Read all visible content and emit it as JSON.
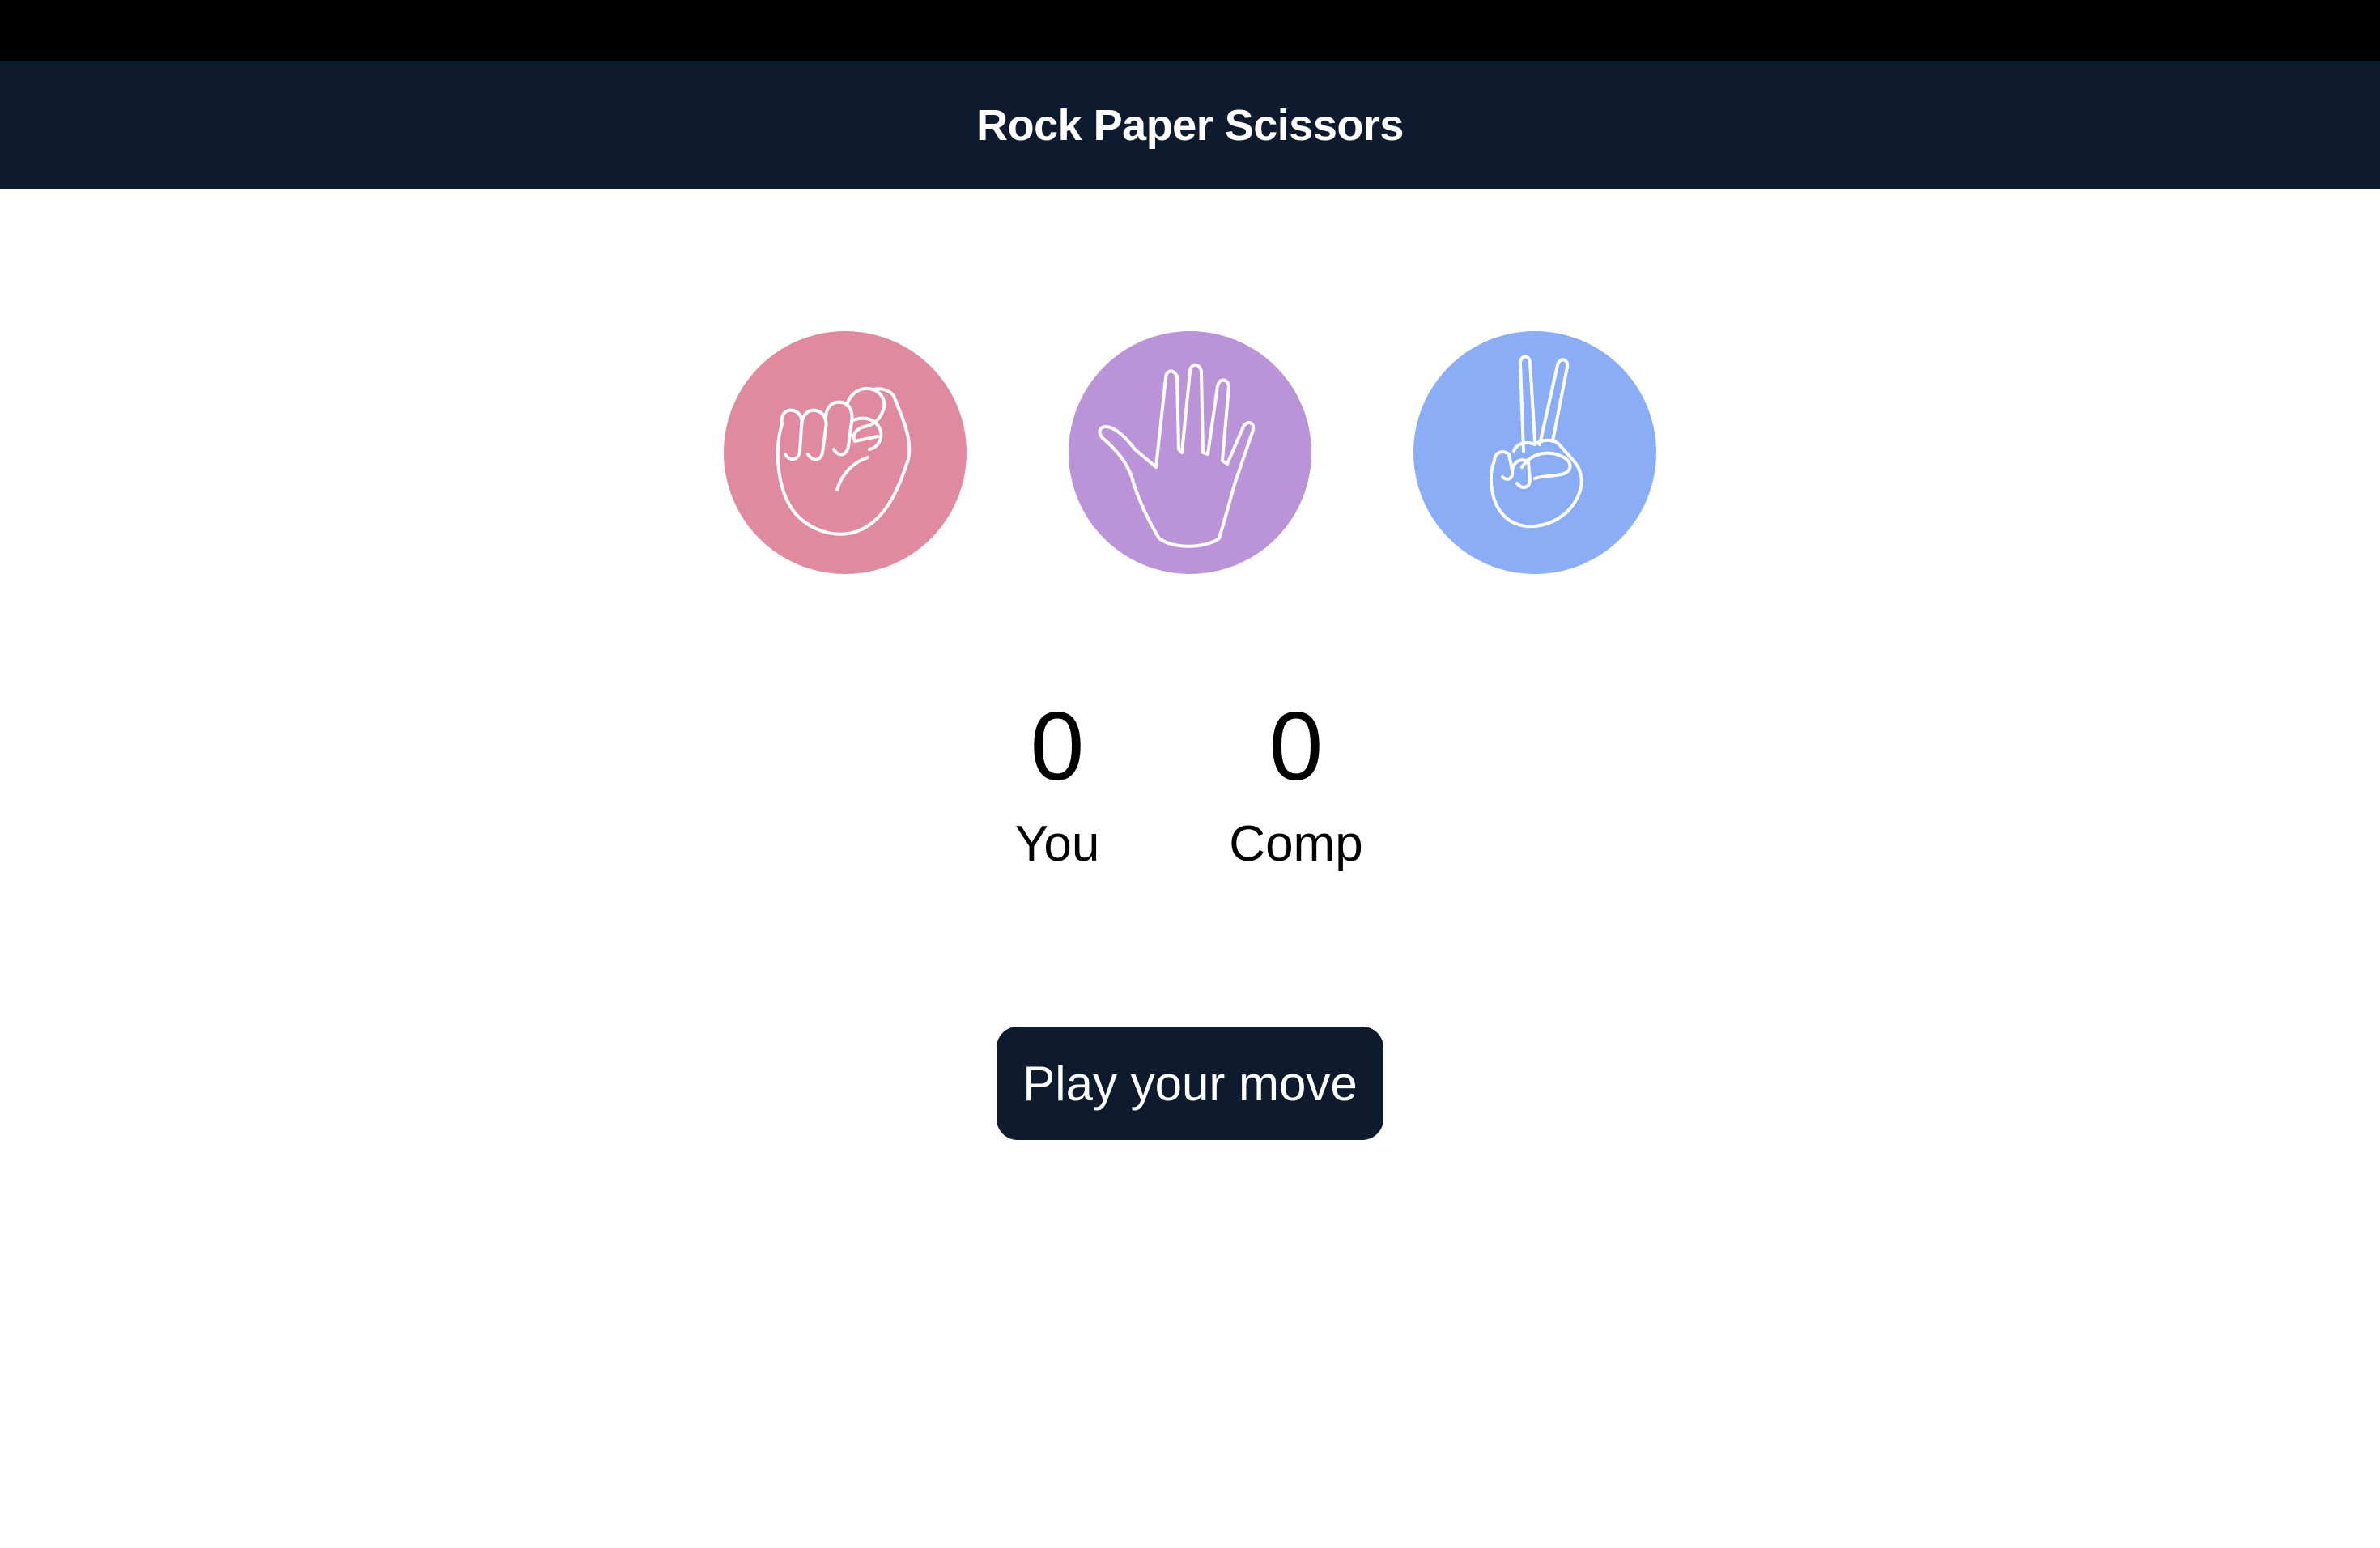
{
  "header": {
    "title": "Rock Paper Scissors"
  },
  "choices": [
    {
      "name": "rock",
      "icon": "fist-icon",
      "color": "#e08aa0"
    },
    {
      "name": "paper",
      "icon": "open-hand-icon",
      "color": "#bb93d8"
    },
    {
      "name": "scissors",
      "icon": "peace-hand-icon",
      "color": "#8aadf6"
    }
  ],
  "scores": {
    "you": {
      "value": "0",
      "label": "You"
    },
    "comp": {
      "value": "0",
      "label": "Comp"
    }
  },
  "play_button": {
    "label": "Play your move"
  },
  "colors": {
    "header_bg": "#0e1a2e",
    "top_bar": "#000000",
    "button_bg": "#0e1a2e"
  }
}
